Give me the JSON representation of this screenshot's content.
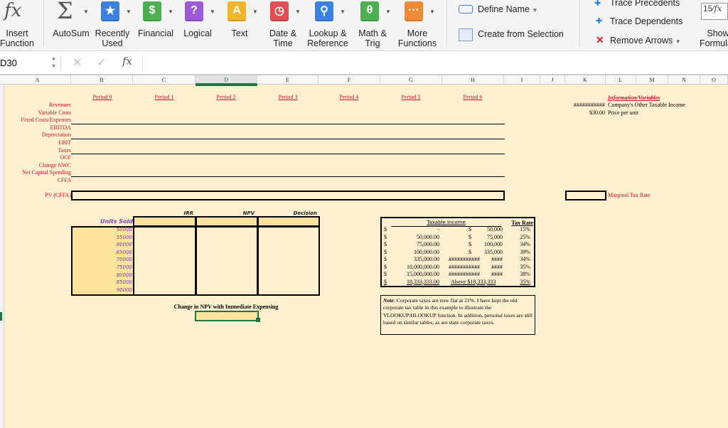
{
  "ribbon": {
    "insert_function": [
      "Insert",
      "Function"
    ],
    "autosum": "AutoSum",
    "recently_used": [
      "Recently",
      "Used"
    ],
    "financial": "Financial",
    "logical": "Logical",
    "text": "Text",
    "date_time": [
      "Date &",
      "Time"
    ],
    "lookup": [
      "Lookup &",
      "Reference"
    ],
    "math": [
      "Math &",
      "Trig"
    ],
    "more": [
      "More",
      "Functions"
    ],
    "define_name": "Define Name",
    "create_from_selection": "Create from Selection",
    "trace_precedents": "Trace Precedents",
    "trace_dependents": "Trace Dependents",
    "remove_arrows": "Remove Arrows",
    "show_formulas": [
      "Show",
      "Formulas"
    ]
  },
  "formula_bar": {
    "name_box": "D30",
    "fx": "fx",
    "value": ""
  },
  "columns": [
    "A",
    "B",
    "C",
    "D",
    "E",
    "F",
    "G",
    "H",
    "I",
    "J",
    "K",
    "L",
    "M",
    "N",
    "O"
  ],
  "selected_column": "D",
  "sheet": {
    "periods": [
      "Period 0",
      "Period 1",
      "Period 2",
      "Period 3",
      "Period 4",
      "Period 5",
      "Period 6"
    ],
    "row_labels": [
      "Revenues",
      "Variable Costs",
      "Fixed Costs/Expenses",
      "EBITDA",
      "Depreciation",
      "EBIT",
      "Taxes",
      "OCF",
      "Change NWC",
      "Net Capital Spending",
      "CFFA"
    ],
    "pv_label": "PV (CFFA)",
    "info": {
      "heading": "Information/Variables",
      "rows": [
        {
          "value": "###########",
          "label": "Company's Other Taxable Income"
        },
        {
          "value": "$30.00",
          "label": "Price per unit"
        }
      ]
    },
    "marginal_tax_rate": "Marginal Tax Rate",
    "sensitivity": {
      "units_label": "Units Sold",
      "headers": [
        "IRR",
        "NPV",
        "Decision"
      ],
      "units": [
        "50000",
        "55000",
        "60000",
        "65000",
        "70000",
        "75000",
        "80000",
        "85000",
        "90000"
      ]
    },
    "change_npv_label": "Change in NPV with Immediate Expensing",
    "tax_table": {
      "header_income": "Taxable Income",
      "header_rate": "Tax Rate",
      "rows": [
        {
          "c1": "$",
          "from": "-",
          "c2": "$",
          "to": "50,000",
          "rate": "15%"
        },
        {
          "c1": "$",
          "from": "50,000.00",
          "c2": "$",
          "to": "75,000",
          "rate": "25%"
        },
        {
          "c1": "$",
          "from": "75,000.00",
          "c2": "$",
          "to": "100,000",
          "rate": "34%"
        },
        {
          "c1": "$",
          "from": "100,000.00",
          "c2": "$",
          "to": "335,000",
          "rate": "39%"
        },
        {
          "c1": "$",
          "from": "335,000.00",
          "c2": "###########",
          "to": "####",
          "rate": "34%"
        },
        {
          "c1": "$",
          "from": "10,000,000.00",
          "c2": "###########",
          "to": "####",
          "rate": "35%"
        },
        {
          "c1": "$",
          "from": "15,000,000.00",
          "c2": "###########",
          "to": "####",
          "rate": "38%"
        },
        {
          "c1": "$",
          "from": "18,333,333.00",
          "c2": "Above $18,333,333",
          "to": "",
          "rate": "35%"
        }
      ]
    },
    "note": {
      "prefix": "Note",
      "text": ": Corporate taxes  are now flat at 21%. I have kept the old corporate tax table in this example to illustrate the VLOOKUP/HLOOKUP function. In addition,  personal taxes are still based on similar tables, as are state corporate taxes."
    }
  },
  "colors": {
    "label_red": "#c8102e",
    "units_purple": "#7a3fb0",
    "sheet_bg": "#fff1d0",
    "header_fill": "#ffe39b",
    "selection_green": "#217346"
  }
}
